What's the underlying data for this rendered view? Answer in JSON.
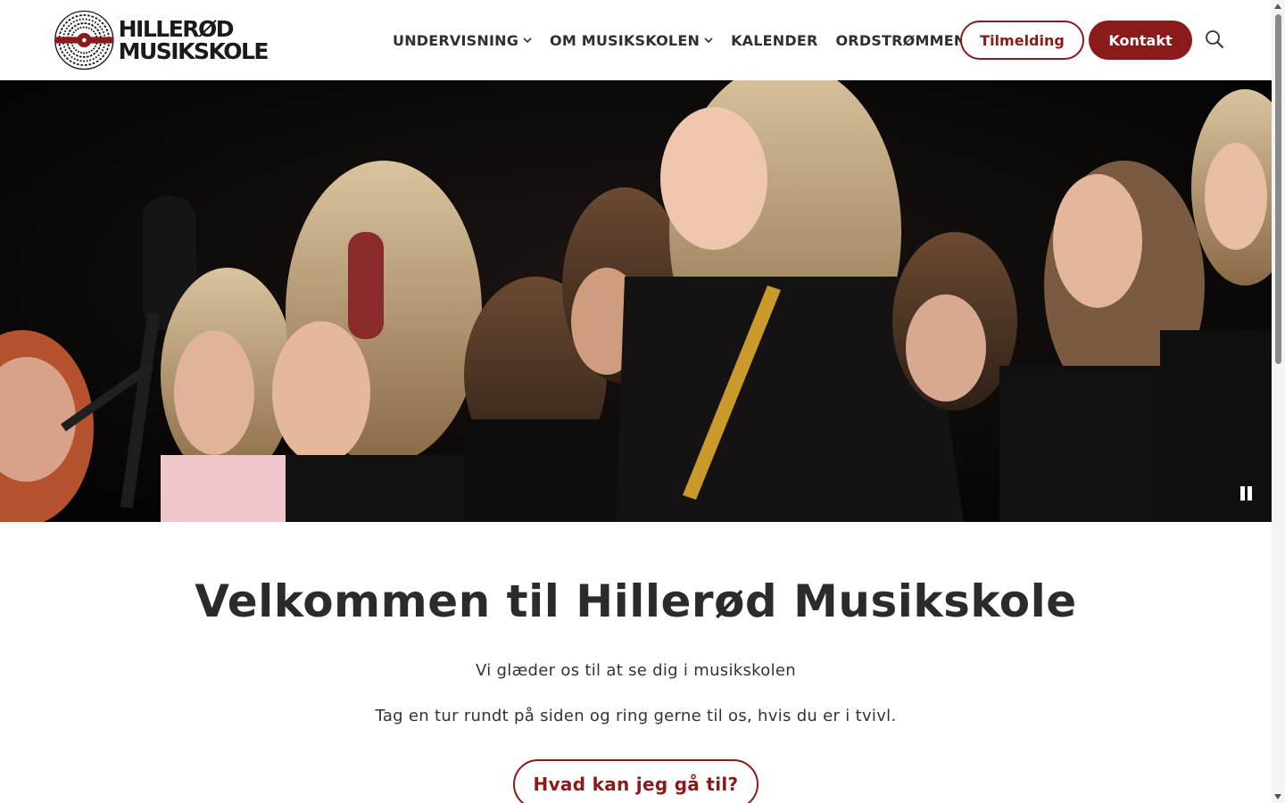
{
  "header": {
    "logo": {
      "line1": "HILLERØD",
      "line2": "MUSIKSKOLE"
    },
    "nav": [
      {
        "label": "UNDERVISNING",
        "dropdown": true
      },
      {
        "label": "OM MUSIKSKOLEN",
        "dropdown": true
      },
      {
        "label": "KALENDER",
        "dropdown": false
      },
      {
        "label": "ORDSTRØMMEN",
        "dropdown": false
      }
    ],
    "signup_label": "Tilmelding",
    "contact_label": "Kontakt"
  },
  "hero": {
    "control": "pause-icon"
  },
  "welcome": {
    "title": "Velkommen til Hillerød Musikskole",
    "line1": "Vi glæder os til at se dig i musikskolen",
    "line2": "Tag en tur rundt på siden og ring gerne til os, hvis du er i tvivl.",
    "cta_label": "Hvad kan jeg gå til?"
  },
  "colors": {
    "brand": "#8b1a1a",
    "text": "#2b2b2b"
  }
}
